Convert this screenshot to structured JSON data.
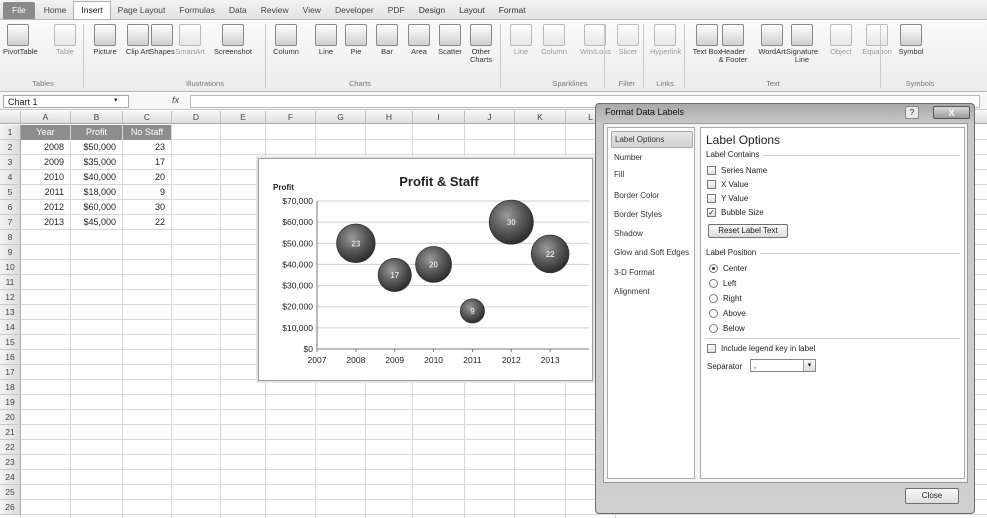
{
  "tabs": [
    "File",
    "Home",
    "Insert",
    "Page Layout",
    "Formulas",
    "Data",
    "Review",
    "View",
    "Developer",
    "PDF",
    "Design",
    "Layout",
    "Format"
  ],
  "ribbon": {
    "buttons": [
      {
        "id": "pivottable",
        "label": "PivotTable",
        "dim": false
      },
      {
        "id": "table",
        "label": "Table",
        "dim": true
      },
      {
        "id": "picture",
        "label": "Picture",
        "dim": false
      },
      {
        "id": "clipart",
        "label": "Clip Art",
        "dim": false
      },
      {
        "id": "shapes",
        "label": "Shapes",
        "dim": false
      },
      {
        "id": "smartart",
        "label": "SmartArt",
        "dim": true
      },
      {
        "id": "screenshot",
        "label": "Screenshot",
        "dim": false
      },
      {
        "id": "column",
        "label": "Column",
        "dim": false
      },
      {
        "id": "line",
        "label": "Line",
        "dim": false
      },
      {
        "id": "pie",
        "label": "Pie",
        "dim": false
      },
      {
        "id": "bar",
        "label": "Bar",
        "dim": false
      },
      {
        "id": "area",
        "label": "Area",
        "dim": false
      },
      {
        "id": "scatter",
        "label": "Scatter",
        "dim": false
      },
      {
        "id": "othercharts",
        "label": "Other Charts",
        "dim": false
      },
      {
        "id": "spark-line",
        "label": "Line",
        "dim": true
      },
      {
        "id": "spark-column",
        "label": "Column",
        "dim": true
      },
      {
        "id": "winloss",
        "label": "Win/Loss",
        "dim": true
      },
      {
        "id": "slicer",
        "label": "Slicer",
        "dim": true
      },
      {
        "id": "hyperlink",
        "label": "Hyperlink",
        "dim": true
      },
      {
        "id": "textbox",
        "label": "Text Box",
        "dim": false
      },
      {
        "id": "headerfooter",
        "label": "Header & Footer",
        "dim": false
      },
      {
        "id": "wordart",
        "label": "WordArt",
        "dim": false
      },
      {
        "id": "signature",
        "label": "Signature Line",
        "dim": false
      },
      {
        "id": "object",
        "label": "Object",
        "dim": true
      },
      {
        "id": "equation",
        "label": "Equation",
        "dim": true
      },
      {
        "id": "symbol",
        "label": "Symbol",
        "dim": false
      }
    ],
    "groups": [
      "Tables",
      "Illustrations",
      "Charts",
      "Sparklines",
      "Filter",
      "Links",
      "Text",
      "Symbols"
    ]
  },
  "formula_bar": {
    "name_box": "Chart 1",
    "fx": "fx",
    "value": ""
  },
  "columns": [
    "A",
    "B",
    "C",
    "D",
    "E",
    "F",
    "G",
    "H",
    "I",
    "J",
    "K",
    "L"
  ],
  "rows": [
    "1",
    "2",
    "3",
    "4",
    "5",
    "6",
    "7",
    "8",
    "9",
    "10",
    "11",
    "12",
    "13",
    "14",
    "15",
    "16",
    "17",
    "18",
    "19",
    "20",
    "21",
    "22",
    "23",
    "24",
    "25",
    "26"
  ],
  "sheet": {
    "headers": [
      "Year",
      "Profit",
      "No Staff"
    ],
    "data": [
      [
        "2008",
        "$50,000",
        "23"
      ],
      [
        "2009",
        "$35,000",
        "17"
      ],
      [
        "2010",
        "$40,000",
        "20"
      ],
      [
        "2011",
        "$18,000",
        "9"
      ],
      [
        "2012",
        "$60,000",
        "30"
      ],
      [
        "2013",
        "$45,000",
        "22"
      ]
    ]
  },
  "chart_data": {
    "type": "bubble",
    "title": "Profit & Staff",
    "ylabel": "Profit",
    "xlabel": "",
    "x_ticks": [
      "2007",
      "2008",
      "2009",
      "2010",
      "2011",
      "2012",
      "2013"
    ],
    "y_ticks": [
      "$70,000",
      "$60,000",
      "$50,000",
      "$40,000",
      "$30,000",
      "$20,000",
      "$10,000",
      "$0"
    ],
    "xlim": [
      2007,
      2014
    ],
    "ylim": [
      0,
      70000
    ],
    "series": [
      {
        "x": [
          2008,
          2009,
          2010,
          2011,
          2012,
          2013
        ],
        "y": [
          50000,
          35000,
          40000,
          18000,
          60000,
          45000
        ],
        "size": [
          23,
          17,
          20,
          9,
          30,
          22
        ],
        "labels": [
          "23",
          "17",
          "20",
          "9",
          "30",
          "22"
        ]
      }
    ],
    "grid": true,
    "legend": "none"
  },
  "dialog": {
    "title": "Format Data Labels",
    "help": "?",
    "close_x": "X",
    "nav": [
      "Label Options",
      "Number",
      "Fill",
      "Border Color",
      "Border Styles",
      "Shadow",
      "Glow and Soft Edges",
      "3-D Format",
      "Alignment"
    ],
    "panel_title": "Label Options",
    "contains_title": "Label Contains",
    "contains": [
      {
        "label": "Series Name",
        "checked": false
      },
      {
        "label": "X Value",
        "checked": false
      },
      {
        "label": "Y Value",
        "checked": false
      },
      {
        "label": "Bubble Size",
        "checked": true
      }
    ],
    "reset_label": "Reset Label Text",
    "position_title": "Label Position",
    "positions": [
      {
        "label": "Center",
        "checked": true
      },
      {
        "label": "Left",
        "checked": false
      },
      {
        "label": "Right",
        "checked": false
      },
      {
        "label": "Above",
        "checked": false
      },
      {
        "label": "Below",
        "checked": false
      }
    ],
    "legend_key": "Include legend key in label",
    "separator_label": "Separator",
    "separator_value": ",",
    "close_button": "Close"
  }
}
